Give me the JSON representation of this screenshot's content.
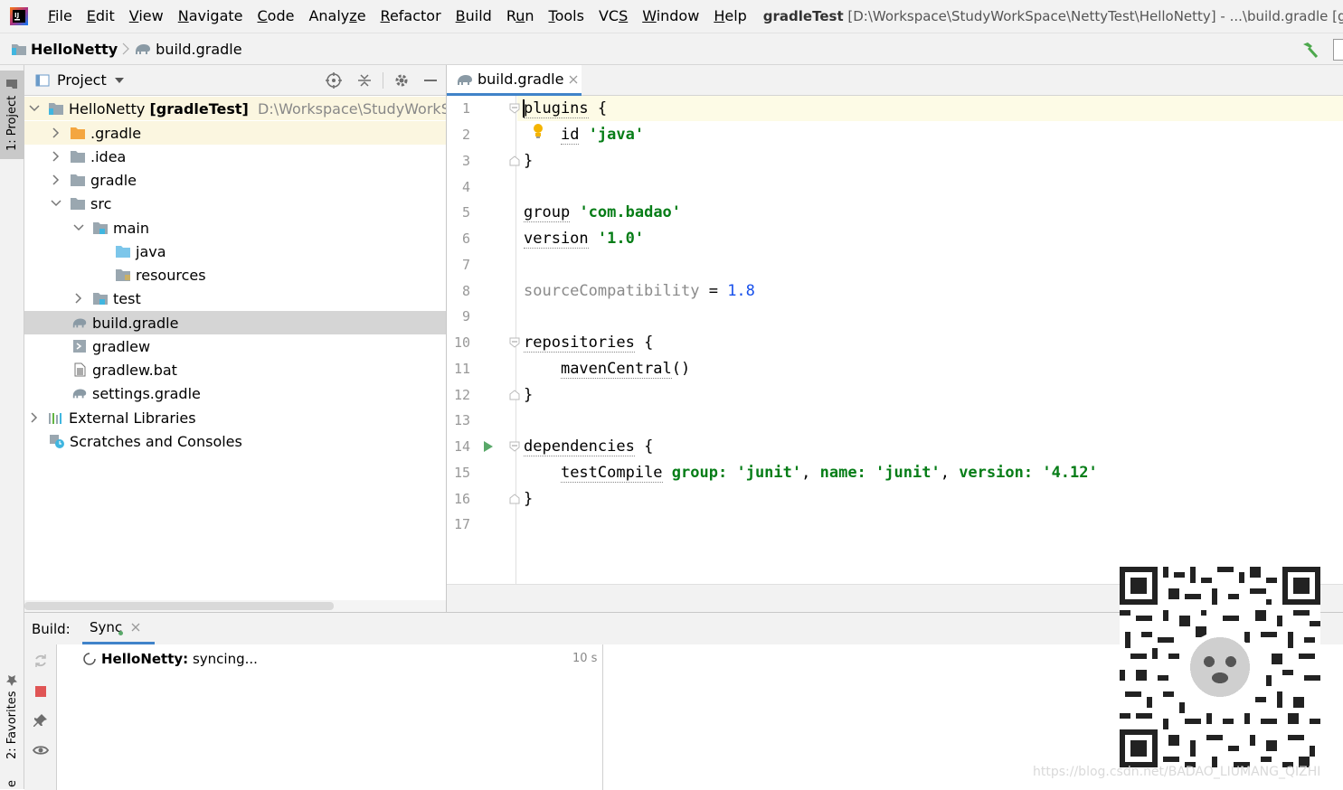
{
  "menu": {
    "items": [
      {
        "label": "File",
        "mnemonic": "F"
      },
      {
        "label": "Edit",
        "mnemonic": "E"
      },
      {
        "label": "View",
        "mnemonic": "V"
      },
      {
        "label": "Navigate",
        "mnemonic": "N"
      },
      {
        "label": "Code",
        "mnemonic": "C"
      },
      {
        "label": "Analyze",
        "mnemonic": "z"
      },
      {
        "label": "Refactor",
        "mnemonic": "R"
      },
      {
        "label": "Build",
        "mnemonic": "B"
      },
      {
        "label": "Run",
        "mnemonic": "u"
      },
      {
        "label": "Tools",
        "mnemonic": "T"
      },
      {
        "label": "VCS",
        "mnemonic": "S"
      },
      {
        "label": "Window",
        "mnemonic": "W"
      },
      {
        "label": "Help",
        "mnemonic": "H"
      }
    ],
    "title_project": "gradleTest",
    "title_rest": "[D:\\Workspace\\StudyWorkSpace\\NettyTest\\HelloNetty] - ...\\build.gradle [gradleTes"
  },
  "navbar": {
    "project": "HelloNetty",
    "file": "build.gradle"
  },
  "left_strip": {
    "project_tab": "1: Project",
    "favorites_tab": "2: Favorites",
    "bottom_tab": "e"
  },
  "project_panel": {
    "title": "Project",
    "root_name": "HelloNetty",
    "root_module": "[gradleTest]",
    "root_path": "D:\\Workspace\\StudyWorkSpace",
    "nodes": [
      {
        "label": ".gradle"
      },
      {
        "label": ".idea"
      },
      {
        "label": "gradle"
      },
      {
        "label": "src"
      },
      {
        "label": "main"
      },
      {
        "label": "java"
      },
      {
        "label": "resources"
      },
      {
        "label": "test"
      },
      {
        "label": "build.gradle"
      },
      {
        "label": "gradlew"
      },
      {
        "label": "gradlew.bat"
      },
      {
        "label": "settings.gradle"
      },
      {
        "label": "External Libraries"
      },
      {
        "label": "Scratches and Consoles"
      }
    ]
  },
  "editor": {
    "tab_label": "build.gradle",
    "line_numbers": [
      "1",
      "2",
      "3",
      "4",
      "5",
      "6",
      "7",
      "8",
      "9",
      "10",
      "11",
      "12",
      "13",
      "14",
      "15",
      "16",
      "17"
    ],
    "code": {
      "l1_kw": "plugins",
      "l1_rest": " {",
      "l2_kw": "id",
      "l2_str": "'java'",
      "l3": "}",
      "l5_kw": "group",
      "l5_str": "'com.badao'",
      "l6_kw": "version",
      "l6_str": "'1.0'",
      "l8_prop": "sourceCompatibility",
      "l8_eq": " = ",
      "l8_num": "1.8",
      "l10_kw": "repositories",
      "l10_rest": " {",
      "l11_kw": "mavenCentral",
      "l11_rest": "()",
      "l12": "}",
      "l14_kw": "dependencies",
      "l14_rest": " {",
      "l15_kw": "testCompile",
      "l15_n1": "group:",
      "l15_v1": "'junit'",
      "l15_n2": "name:",
      "l15_v2": "'junit'",
      "l15_n3": "version:",
      "l15_v3": "'4.12'",
      "l16": "}"
    }
  },
  "build_panel": {
    "label": "Build:",
    "tab": "Sync",
    "task_project": "HelloNetty:",
    "task_status": "syncing...",
    "elapsed": "10 s"
  },
  "watermark": "https://blog.csdn.net/BADAO_LIUMANG_QIZHI",
  "colors": {
    "string": "#067d17",
    "number": "#1750eb",
    "selection": "#d5d5d5",
    "caret_line": "#fdfbe6",
    "tab_underline": "#4083c9"
  }
}
